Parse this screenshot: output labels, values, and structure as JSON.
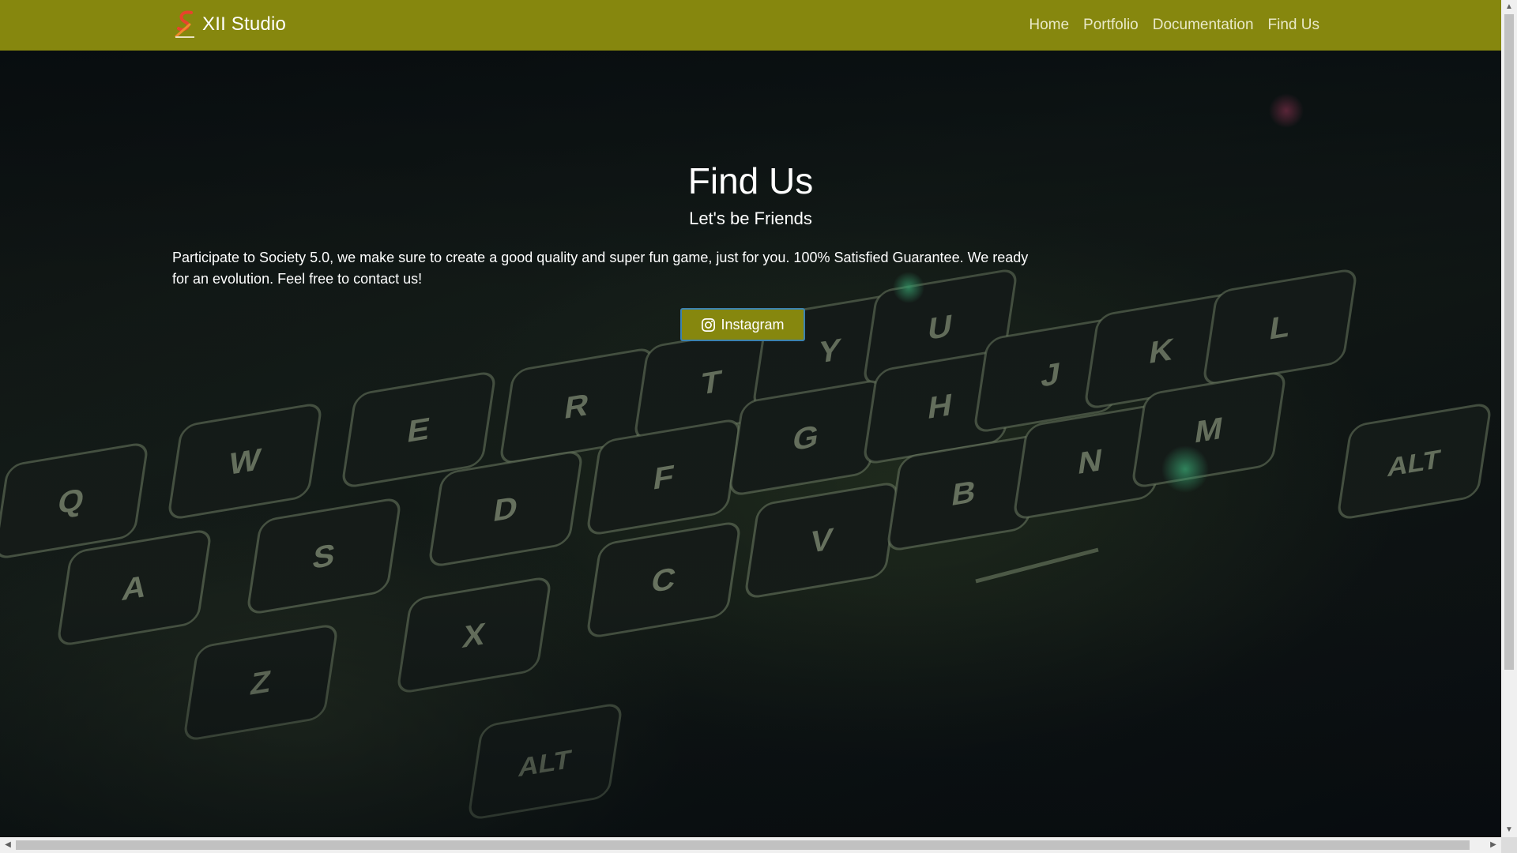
{
  "navbar": {
    "brand": "XII Studio",
    "links": [
      "Home",
      "Portfolio",
      "Documentation",
      "Find Us"
    ]
  },
  "hero": {
    "title": "Find Us",
    "subtitle": "Let's be Friends",
    "description": "Participate to Society 5.0, we make sure to create a good quality and super fun game, just for you. 100% Satisfied Guarantee. We ready for an evolution. Feel free to contact us!",
    "button_label": "Instagram",
    "button_icon": "instagram-icon",
    "keyboard_keys": [
      "Q",
      "W",
      "E",
      "R",
      "T",
      "Y",
      "U",
      "A",
      "S",
      "D",
      "F",
      "G",
      "H",
      "J",
      "K",
      "L",
      "Z",
      "X",
      "C",
      "V",
      "B",
      "N",
      "M",
      "ALT",
      "ALT"
    ]
  },
  "colors": {
    "accent": "#86870e",
    "button_border": "#3b82b0"
  }
}
